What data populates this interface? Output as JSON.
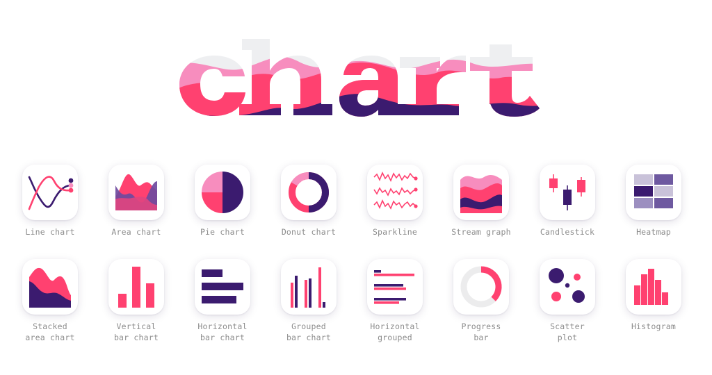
{
  "logo": {
    "text": "chart",
    "colors": {
      "gray": "#eeeff1",
      "pink": "#f78dbe",
      "red": "#ff4170",
      "purple": "#3b1b6f"
    }
  },
  "charts": {
    "line": {
      "label": "Line chart",
      "icon": "line-chart-icon"
    },
    "area": {
      "label": "Area chart",
      "icon": "area-chart-icon"
    },
    "pie": {
      "label": "Pie chart",
      "icon": "pie-chart-icon"
    },
    "donut": {
      "label": "Donut chart",
      "icon": "donut-chart-icon"
    },
    "sparkline": {
      "label": "Sparkline",
      "icon": "sparkline-icon"
    },
    "stream": {
      "label": "Stream graph",
      "icon": "stream-graph-icon"
    },
    "candlestick": {
      "label": "Candlestick",
      "icon": "candlestick-icon"
    },
    "heatmap": {
      "label": "Heatmap",
      "icon": "heatmap-icon"
    },
    "stacked_area": {
      "label": "Stacked\narea chart",
      "icon": "stacked-area-chart-icon"
    },
    "vertical_bar": {
      "label": "Vertical\nbar chart",
      "icon": "vertical-bar-chart-icon"
    },
    "horizontal_bar": {
      "label": "Horizontal\nbar chart",
      "icon": "horizontal-bar-chart-icon"
    },
    "grouped_bar": {
      "label": "Grouped\nbar chart",
      "icon": "grouped-bar-chart-icon"
    },
    "horizontal_grouped": {
      "label": "Horizontal\ngrouped",
      "icon": "horizontal-grouped-icon"
    },
    "progress": {
      "label": "Progress\nbar",
      "icon": "progress-bar-icon"
    },
    "scatter": {
      "label": "Scatter\nplot",
      "icon": "scatter-plot-icon"
    },
    "histogram": {
      "label": "Histogram",
      "icon": "histogram-icon"
    }
  }
}
